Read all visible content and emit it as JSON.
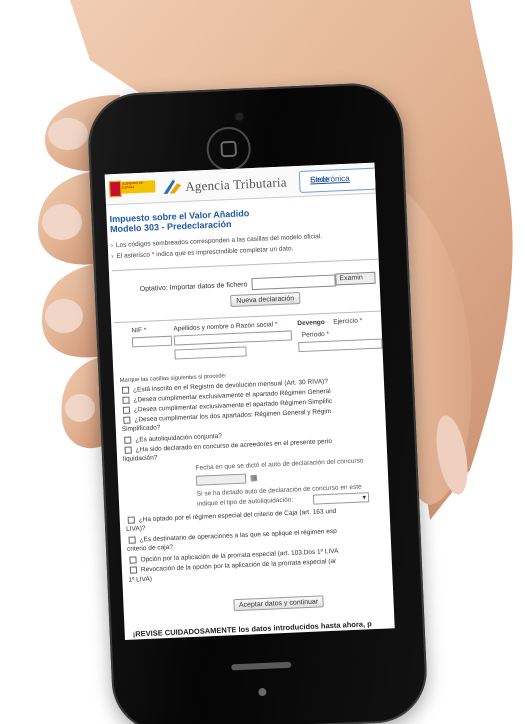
{
  "header": {
    "logo_text": "GOBIERNO DE ESPAÑA",
    "agency": "Agencia Tributaria",
    "sede_line1": "Sede ",
    "sede_line1_link": "Electrónica"
  },
  "page": {
    "title_line1": "Impuesto sobre el Valor Añadido",
    "title_line2": "Modelo 303 - Predeclaración",
    "note1": "Los códigos sombreados corresponden a las casillas del modelo oficial.",
    "note2_pre": "El asterisco ",
    "note2_star": "*",
    "note2_post": " indica que es imprescindible completar un dato."
  },
  "import": {
    "label": "Optativo: Importar datos de fichero",
    "browse_label": "Examin",
    "new_button": "Nueva declaración"
  },
  "form": {
    "nif_label": "NIF",
    "name_label": "Apellidos y nombre o Razón social",
    "star": "*",
    "devengo_label": "Devengo",
    "ejercicio_label": "Ejercicio",
    "periodo_label": "Período"
  },
  "checks": {
    "intro": "Marque las casillas siguientes si procede:",
    "items": [
      "¿Está inscrito en el Registro de devolución mensual (Art. 30 RIVA)?",
      "¿Desea cumplimentar exclusivamente el apartado Régimen General",
      "¿Desea cumplimentar exclusivamente el apartado Régimen Simplific",
      "¿Desea cumplimentar los dos apartados: Régimen General y Régim",
      "Simplificado?",
      "¿Es autoliquidación conjunta?",
      "¿Ha sido declarado en concurso de acreedores en el presente perío",
      "liquidación?",
      "Fecha en que se dictó el auto de declaración del concurso",
      "Si se ha dictado auto de declaración de concurso en este",
      "indique el tipo de autoliquidación:",
      "¿Ha optado por el régimen especial del criterio de Caja (art. 163 und",
      "LIVA)?",
      "¿Es destinatario de operaciones a las que se aplique el régimen esp",
      "criterio de caja?",
      "Opción por la aplicación de la prorrata especial (art. 103.Dos 1º LIVA",
      "Revocación de la opción por la aplicación de la prorrata especial (ar",
      "1º LIVA)"
    ],
    "calendar_glyph": "▦",
    "select_glyph": "▾"
  },
  "footer": {
    "accept_button": "Aceptar datos y continuar",
    "warning": "¡REVISE CUIDADOSAMENTE los datos introducidos hasta ahora, p"
  },
  "colors": {
    "accent": "#1f5aa6",
    "required": "#d00000",
    "skin": "#e4b79a"
  }
}
